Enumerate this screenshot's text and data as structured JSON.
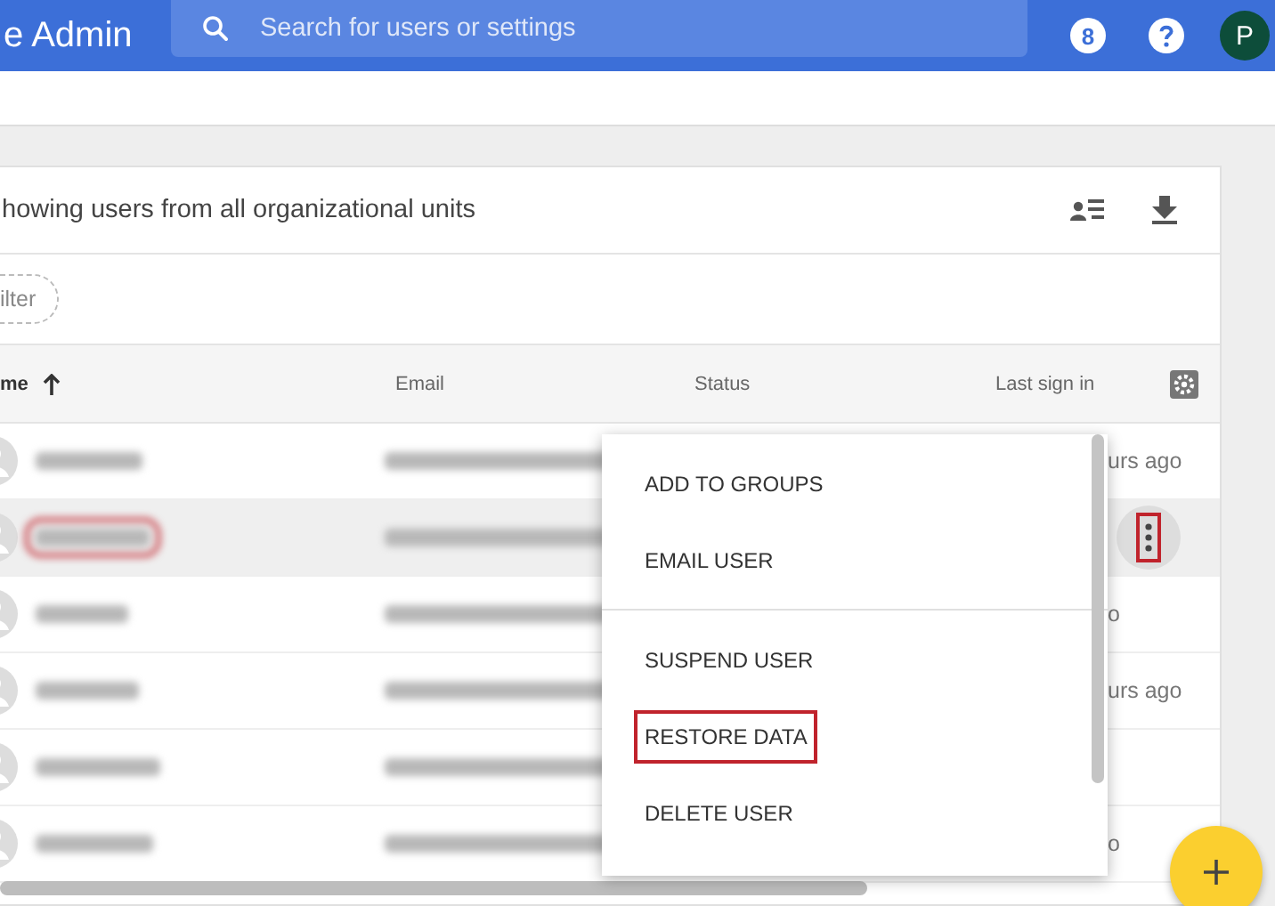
{
  "header": {
    "title": "e Admin",
    "search": {
      "placeholder": "Search for users or settings"
    },
    "badge": "8",
    "avatar": "P"
  },
  "card": {
    "title": "howing users from all organizational units",
    "filter_chip": "ilter",
    "columns": [
      {
        "label": "me",
        "sorted_ascending": true
      },
      {
        "label": "Email"
      },
      {
        "label": "Status"
      },
      {
        "label": "Last sign in"
      }
    ],
    "rows": [
      {
        "selected": false,
        "name_highlighted": false,
        "menu_open": false,
        "last_sign_in": "urs ago"
      },
      {
        "selected": true,
        "name_highlighted": true,
        "menu_open": true
      },
      {
        "selected": false,
        "name_highlighted": false,
        "menu_open": false,
        "last_sign_in": "o"
      },
      {
        "selected": false,
        "name_highlighted": false,
        "menu_open": false,
        "last_sign_in": "urs ago"
      },
      {
        "selected": false,
        "name_highlighted": false,
        "menu_open": false
      },
      {
        "selected": false,
        "name_highlighted": false,
        "menu_open": false,
        "last_sign_in": "o"
      }
    ]
  },
  "context_menu": {
    "items": [
      {
        "label": "ADD TO GROUPS",
        "divider_before": false,
        "highlighted": false
      },
      {
        "label": "EMAIL USER",
        "divider_before": false,
        "highlighted": false
      },
      {
        "label": "SUSPEND USER",
        "divider_before": true,
        "highlighted": false
      },
      {
        "label": "RESTORE DATA",
        "divider_before": false,
        "highlighted": true
      },
      {
        "label": "DELETE USER",
        "divider_before": false,
        "highlighted": false
      }
    ]
  }
}
